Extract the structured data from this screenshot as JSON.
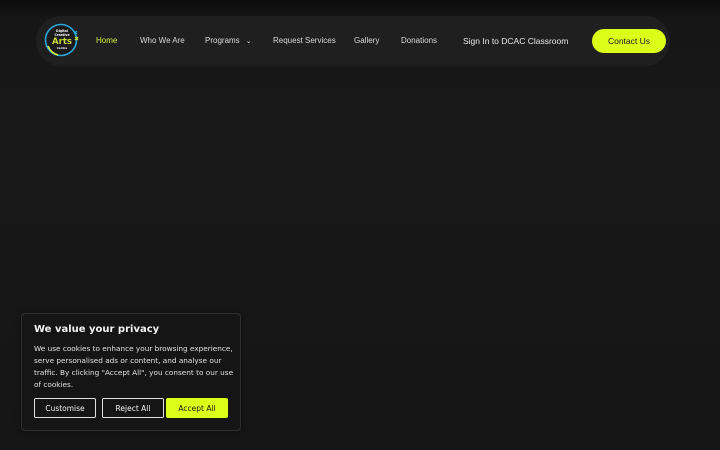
{
  "header": {
    "logo": {
      "line1": "Digital",
      "line2": "Creative",
      "line3": "Arts",
      "line4": "Centre",
      "icon": "dcac-logo-icon"
    },
    "nav": [
      {
        "label": "Home",
        "active": true
      },
      {
        "label": "Who We Are"
      },
      {
        "label": "Programs",
        "has_dropdown": true,
        "icon": "chevron-down-icon"
      },
      {
        "label": "Request Services"
      },
      {
        "label": "Gallery"
      },
      {
        "label": "Donations"
      },
      {
        "label": "Sign In to DCAC Classroom"
      }
    ],
    "cta": "Contact Us",
    "colors": {
      "accent": "#dcff1a",
      "active_link": "#d6f23a",
      "bar": "#1f1f1f",
      "background": "#161616"
    }
  },
  "cookie_banner": {
    "title": "We value your privacy",
    "text": "We use cookies to enhance your browsing experience, serve personalised ads or content, and analyse our traffic. By clicking \"Accept All\", you consent to our use of cookies.",
    "buttons": {
      "customise": "Customise",
      "reject": "Reject All",
      "accept": "Accept All"
    }
  }
}
